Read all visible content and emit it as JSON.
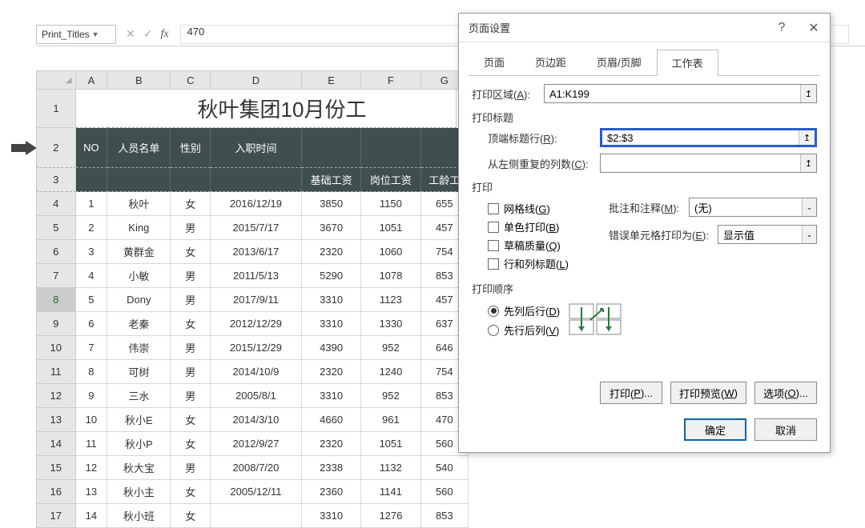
{
  "formula_bar": {
    "name_box": "Print_Titles",
    "formula_value": "470"
  },
  "columns": [
    "A",
    "B",
    "C",
    "D",
    "E",
    "F",
    "G"
  ],
  "row_headers": [
    "1",
    "2",
    "3",
    "4",
    "5",
    "6",
    "7",
    "8",
    "9",
    "10",
    "11",
    "12",
    "13",
    "14",
    "15",
    "16",
    "17"
  ],
  "sheet_title": "秋叶集团10月份工",
  "header_row2": {
    "no": "NO",
    "name": "人员名单",
    "sex": "性别",
    "date": "入职时间"
  },
  "header_row3": {
    "e": "基础工资",
    "f": "岗位工资",
    "g": "工龄工"
  },
  "data_rows": [
    {
      "no": "1",
      "name": "秋叶",
      "sex": "女",
      "date": "2016/12/19",
      "e": "3850",
      "f": "1150",
      "g": "655"
    },
    {
      "no": "2",
      "name": "King",
      "sex": "男",
      "date": "2015/7/17",
      "e": "3670",
      "f": "1051",
      "g": "457"
    },
    {
      "no": "3",
      "name": "黄群金",
      "sex": "女",
      "date": "2013/6/17",
      "e": "2320",
      "f": "1060",
      "g": "754"
    },
    {
      "no": "4",
      "name": "小敏",
      "sex": "男",
      "date": "2011/5/13",
      "e": "5290",
      "f": "1078",
      "g": "853"
    },
    {
      "no": "5",
      "name": "Dony",
      "sex": "男",
      "date": "2017/9/11",
      "e": "3310",
      "f": "1123",
      "g": "457"
    },
    {
      "no": "6",
      "name": "老秦",
      "sex": "女",
      "date": "2012/12/29",
      "e": "3310",
      "f": "1330",
      "g": "637"
    },
    {
      "no": "7",
      "name": "伟崇",
      "sex": "男",
      "date": "2015/12/29",
      "e": "4390",
      "f": "952",
      "g": "646"
    },
    {
      "no": "8",
      "name": "可树",
      "sex": "男",
      "date": "2014/10/9",
      "e": "2320",
      "f": "1240",
      "g": "754"
    },
    {
      "no": "9",
      "name": "三水",
      "sex": "男",
      "date": "2005/8/1",
      "e": "3310",
      "f": "952",
      "g": "853"
    },
    {
      "no": "10",
      "name": "秋小E",
      "sex": "女",
      "date": "2014/3/10",
      "e": "4660",
      "f": "961",
      "g": "470"
    },
    {
      "no": "11",
      "name": "秋小P",
      "sex": "女",
      "date": "2012/9/27",
      "e": "2320",
      "f": "1051",
      "g": "560"
    },
    {
      "no": "12",
      "name": "秋大宝",
      "sex": "男",
      "date": "2008/7/20",
      "e": "2338",
      "f": "1132",
      "g": "540"
    },
    {
      "no": "13",
      "name": "秋小主",
      "sex": "女",
      "date": "2005/12/11",
      "e": "2360",
      "f": "1141",
      "g": "560"
    },
    {
      "no": "14",
      "name": "秋小班",
      "sex": "女",
      "date": "",
      "e": "3310",
      "f": "1276",
      "g": "853"
    }
  ],
  "dialog": {
    "title": "页面设置",
    "tabs": [
      "页面",
      "页边距",
      "页眉/页脚",
      "工作表"
    ],
    "print_area_label": "打印区域(A):",
    "print_area_value": "A1:K199",
    "print_titles_label": "打印标题",
    "top_rows_label": "顶端标题行(R):",
    "top_rows_value": "$2:$3",
    "left_cols_label": "从左侧重复的列数(C):",
    "left_cols_value": "",
    "print_section": "打印",
    "cb_grid": "网格线(G)",
    "cb_mono": "单色打印(B)",
    "cb_draft": "草稿质量(Q)",
    "cb_rc": "行和列标题(L)",
    "comments_label": "批注和注释(M):",
    "comments_value": "(无)",
    "errors_label": "错误单元格打印为(E):",
    "errors_value": "显示值",
    "order_section": "打印顺序",
    "radio1": "先列后行(D)",
    "radio2": "先行后列(V)",
    "btn_print": "打印(P)...",
    "btn_preview": "打印预览(W)",
    "btn_options": "选项(O)...",
    "btn_ok": "确定",
    "btn_cancel": "取消"
  }
}
